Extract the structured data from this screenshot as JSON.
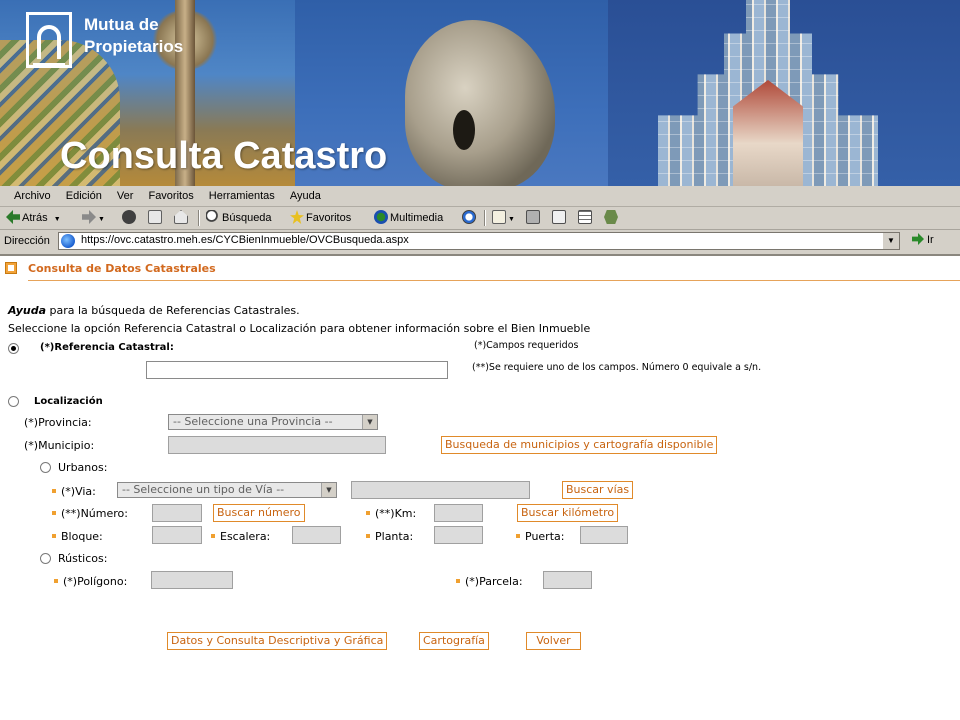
{
  "banner": {
    "logo_line1": "Mutua de",
    "logo_line2": "Propietarios",
    "title": "Consulta Catastro"
  },
  "browser": {
    "menu": [
      "Archivo",
      "Edición",
      "Ver",
      "Favoritos",
      "Herramientas",
      "Ayuda"
    ],
    "toolbar": {
      "back": "Atrás",
      "search": "Búsqueda",
      "favorites": "Favoritos",
      "media": "Multimedia"
    },
    "address_label": "Dirección",
    "url": "https://ovc.catastro.meh.es/CYCBienInmueble/OVCBusqueda.aspx",
    "go": "Ir"
  },
  "page": {
    "section_title": "Consulta de Datos Catastrales",
    "help_bold": "Ayuda",
    "help_rest": " para la búsqueda de Referencias Catastrales.",
    "instructions": "Seleccione la opción Referencia Catastral o Localización para obtener información sobre el Bien Inmueble",
    "ref_label": "(*)Referencia Catastral:",
    "ref_value": "",
    "req_note": "(*)Campos requeridos",
    "req_note2": "(**)Se requiere uno de los campos. Número 0 equivale a s/n.",
    "loc_label": "Localización",
    "provincia_label": "(*)Provincia:",
    "provincia_select": "-- Seleccione una Provincia --",
    "municipio_label": "(*)Municipio:",
    "municipio_button": "Busqueda de municipios y cartografía disponible",
    "urbanos_label": "Urbanos:",
    "via_label": "(*)Via:",
    "via_select": "-- Seleccione un tipo de Vía --",
    "buscar_vias": "Buscar vías",
    "numero_label": "(**)Número:",
    "buscar_numero": "Buscar número",
    "km_label": "(**)Km:",
    "buscar_km": "Buscar kilómetro",
    "bloque_label": "Bloque:",
    "escalera_label": "Escalera:",
    "planta_label": "Planta:",
    "puerta_label": "Puerta:",
    "rusticos_label": "Rústicos:",
    "poligono_label": "(*)Polígono:",
    "parcela_label": "(*)Parcela:",
    "btn_datos": "Datos y Consulta Descriptiva y Gráfica",
    "btn_cartografia": "Cartografía",
    "btn_volver": "Volver"
  },
  "colors": {
    "accent_orange": "#d2691e",
    "chrome_grey": "#d4d0c8",
    "banner_blue": "#2f5fa8"
  }
}
